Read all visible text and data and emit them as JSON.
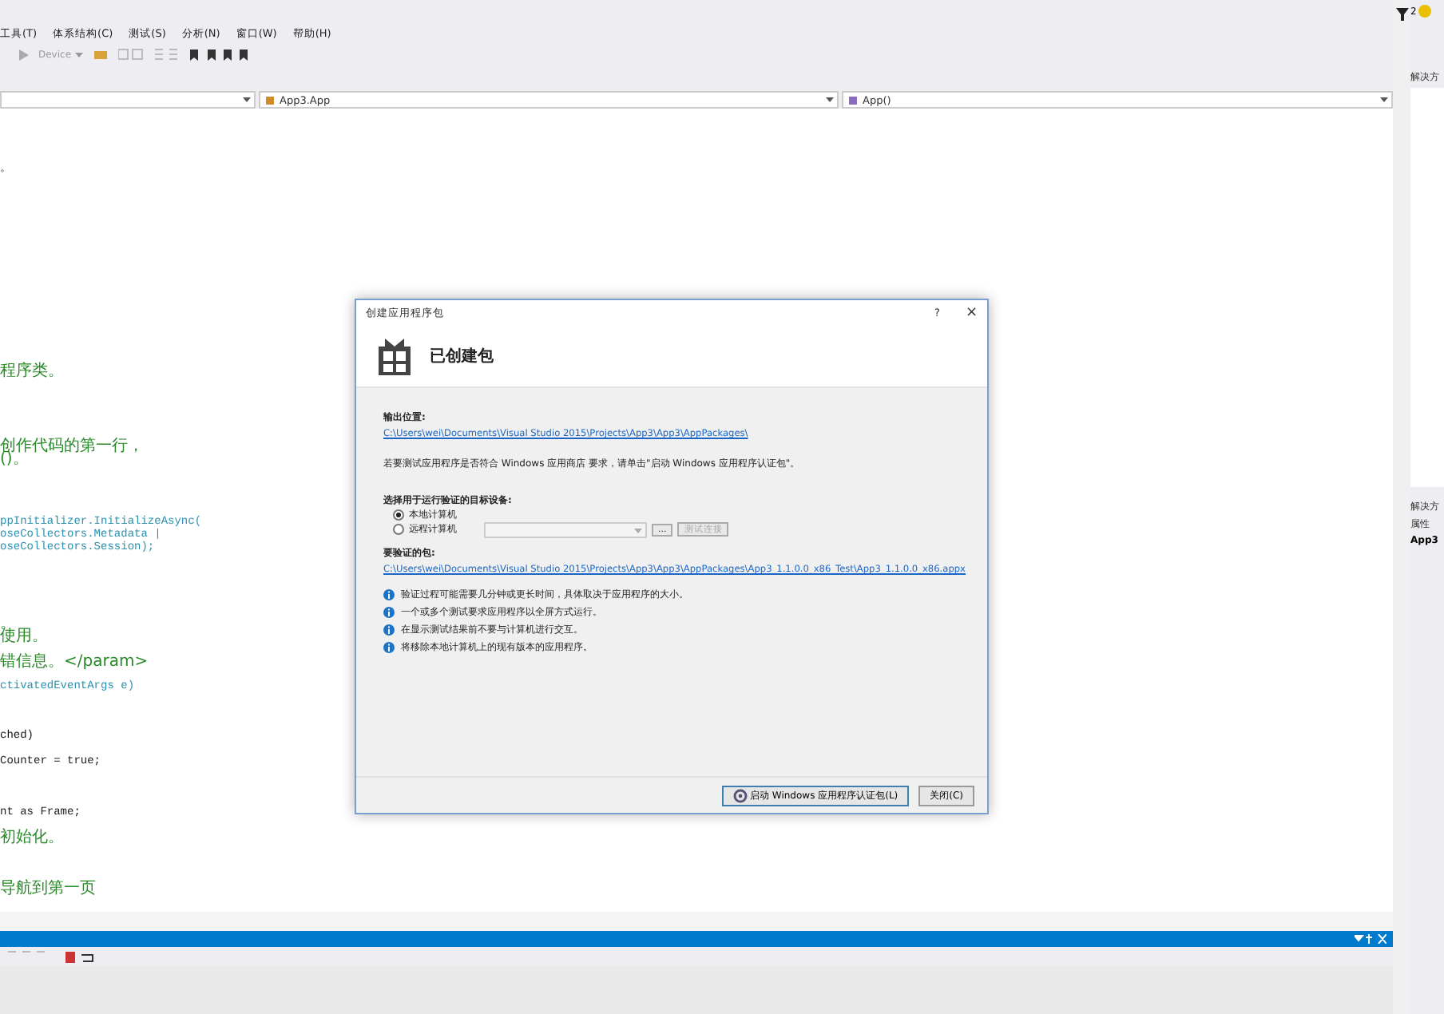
{
  "menu": [
    "工具(T)",
    "体系结构(C)",
    "测试(S)",
    "分析(N)",
    "窗口(W)",
    "帮助(H)"
  ],
  "top_right": {
    "notifications": "2"
  },
  "toolbar": {
    "device": "Device"
  },
  "nav_bar": {
    "type": "App3.App",
    "member": "App()"
  },
  "code_lines": [
    {
      "text": "。",
      "kind": "plain"
    },
    {
      "text": "程序类。",
      "kind": "comment"
    },
    {
      "text": "创作代码的第一行，",
      "kind": "comment"
    },
    {
      "text": "()。",
      "kind": "comment"
    },
    {
      "text": "ppInitializer.InitializeAsync(",
      "kind": "type"
    },
    {
      "text": "oseCollectors.Metadata |",
      "kind": "type"
    },
    {
      "text": "oseCollectors.Session);",
      "kind": "type"
    },
    {
      "text": "。",
      "kind": "comment"
    },
    {
      "text": "使用。",
      "kind": "comment"
    },
    {
      "text": "错信息。</param>",
      "kind": "comment"
    },
    {
      "text": "ctivatedEventArgs e)",
      "kind": "type"
    },
    {
      "text": "ched)",
      "kind": "plain"
    },
    {
      "text": "Counter = true;",
      "kind": "keyword"
    },
    {
      "text": "nt as Frame;",
      "kind": "keyword"
    },
    {
      "text": "初始化。",
      "kind": "comment"
    },
    {
      "text": "导航到第一页",
      "kind": "comment"
    }
  ],
  "dialog": {
    "title": "创建应用程序包",
    "help": "?",
    "close": "×",
    "heading": "已创建包",
    "output_label": "输出位置:",
    "output_link": "C:\\Users\\wei\\Documents\\Visual Studio 2015\\Projects\\App3\\App3\\AppPackages\\",
    "note": "若要测试应用程序是否符合 Windows 应用商店 要求，请单击\"启动 Windows 应用程序认证包\"。",
    "target_label": "选择用于运行验证的目标设备:",
    "targets": [
      {
        "label": "本地计算机",
        "selected": true
      },
      {
        "label": "远程计算机",
        "selected": false
      }
    ],
    "browse": "...",
    "test_connection": "测试连接",
    "package_label": "要验证的包:",
    "package_link": "C:\\Users\\wei\\Documents\\Visual Studio 2015\\Projects\\App3\\App3\\AppPackages\\App3_1.1.0.0_x86_Test\\App3_1.1.0.0_x86.appx",
    "info": [
      "验证过程可能需要几分钟或更长时间，具体取决于应用程序的大小。",
      "一个或多个测试要求应用程序以全屏方式运行。",
      "在显示测试结果前不要与计算机进行交互。",
      "将移除本地计算机上的现有版本的应用程序。"
    ],
    "buttons": [
      {
        "label": "启动 Windows 应用程序认证包(L)",
        "kind": "launch"
      },
      {
        "label": "关闭(C)",
        "kind": "plain"
      }
    ]
  },
  "right_panel": {
    "header": "解决方",
    "lower_header": "解决方",
    "properties": "属性",
    "object": "App3"
  }
}
